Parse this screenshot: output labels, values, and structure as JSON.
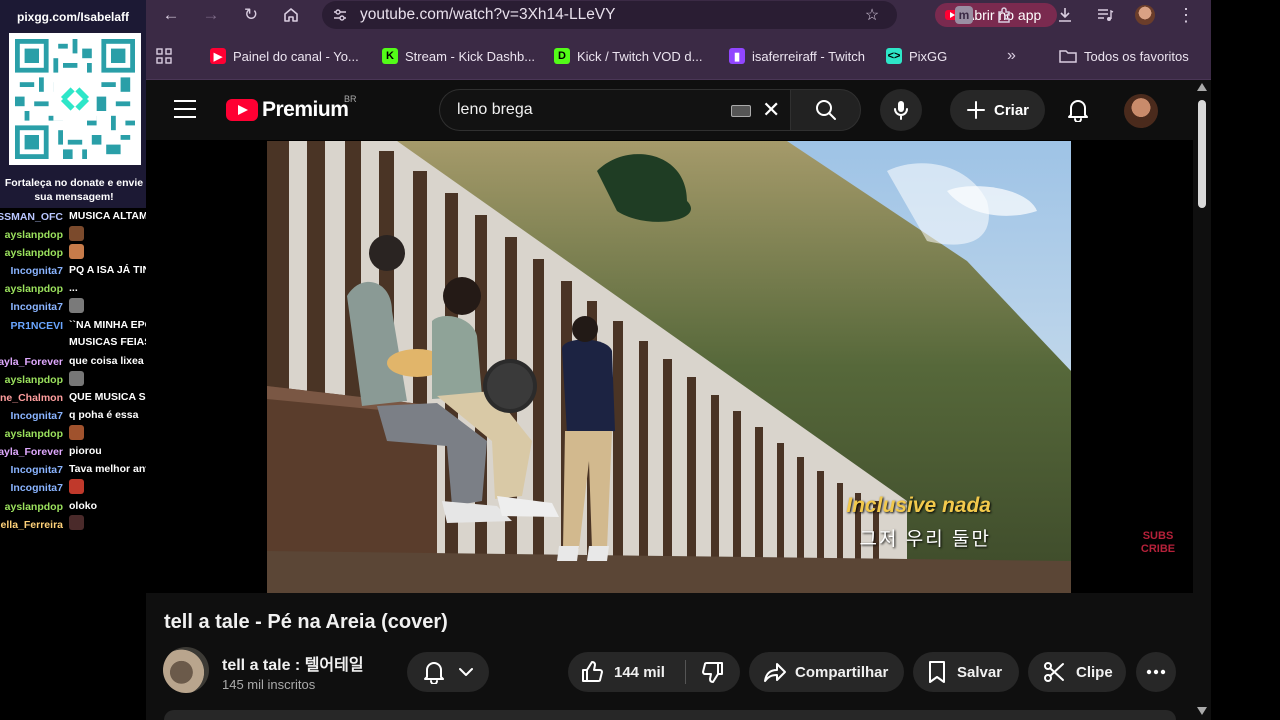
{
  "overlay": {
    "qr_url": "pixgg.com/Isabelaff",
    "qr_message": "Fortaleça no donate e envie sua mensagem!",
    "chat": [
      {
        "user": "SSMAN_OFC",
        "color": "#b9c6ff",
        "message": "MUSICA ALTAMENTE LIXOSA"
      },
      {
        "user": "ayslanpdop",
        "color": "#9be15d",
        "message": "",
        "emote": "#7b4a2c"
      },
      {
        "user": "ayslanpdop",
        "color": "#9be15d",
        "message": "",
        "emote": "#c77b4a"
      },
      {
        "user": "Incognita7",
        "color": "#8ab4ff",
        "message": "PQ A ISA JÁ TINHA OUVIDO ISSO???"
      },
      {
        "user": "ayslanpdop",
        "color": "#9be15d",
        "message": "..."
      },
      {
        "user": "Incognita7",
        "color": "#8ab4ff",
        "message": "",
        "emote": "#7a7a7a"
      },
      {
        "user": "PR1NCEVI",
        "color": "#6aa6ff",
        "message": "``NA MINHA EPOCA NAO TINHA ESSAS MUSICAS FEIAS``",
        "two_line": true
      },
      {
        "user": "ayla_Forever",
        "color": "#e0a9ff",
        "message": "que coisa lixea"
      },
      {
        "user": "ayslanpdop",
        "color": "#9be15d",
        "message": "",
        "emote": "#777777"
      },
      {
        "user": "ne_Chalmon",
        "color": "#ff9e9e",
        "message": "QUE MUSICA SATÂNICA"
      },
      {
        "user": "Incognita7",
        "color": "#8ab4ff",
        "message": "q poha é essa"
      },
      {
        "user": "ayslanpdop",
        "color": "#9be15d",
        "message": "",
        "emote": "#a0522d"
      },
      {
        "user": "ayla_Forever",
        "color": "#e0a9ff",
        "message": "piorou"
      },
      {
        "user": "Incognita7",
        "color": "#8ab4ff",
        "message": "Tava melhor antes"
      },
      {
        "user": "Incognita7",
        "color": "#8ab4ff",
        "message": "",
        "emote": "#c0392b"
      },
      {
        "user": "ayslanpdop",
        "color": "#9be15d",
        "message": "oloko"
      },
      {
        "user": "ella_Ferreira",
        "color": "#ffd27a",
        "message": "",
        "emote": "#4a2a2a"
      }
    ]
  },
  "browser": {
    "url": "youtube.com/watch?v=3Xh14-LLeVY",
    "open_app_label": "Abrir no app",
    "bookmarks": [
      {
        "label": "Painel do canal - Yo...",
        "icon_color": "#ff0033",
        "icon_char": "▶"
      },
      {
        "label": "Stream - Kick Dashb...",
        "icon_color": "#53fc18",
        "icon_char": "K"
      },
      {
        "label": "Kick / Twitch VOD d...",
        "icon_color": "#53fc18",
        "icon_char": "D"
      },
      {
        "label": "isaferreiraff - Twitch",
        "icon_color": "#9146ff",
        "icon_char": "▮"
      },
      {
        "label": "PixGG",
        "icon_color": "#2ee6c8",
        "icon_char": "<>"
      }
    ],
    "more_label": "»",
    "all_favorites_label": "Todos os favoritos"
  },
  "youtube": {
    "logo_text": "Premium",
    "logo_region": "BR",
    "search_value": "leno brega",
    "create_label": "Criar",
    "video": {
      "subtitle_pt": "Inclusive nada",
      "subtitle_kr": "그저 우리 둘만",
      "watermark": "SUBS CRIBE"
    },
    "title": "tell a tale - Pé na Areia (cover)",
    "channel_name": "tell a tale : 텔어테일",
    "subscribers": "145 mil inscritos",
    "likes": "144 mil",
    "share_label": "Compartilhar",
    "save_label": "Salvar",
    "clip_label": "Clipe"
  }
}
